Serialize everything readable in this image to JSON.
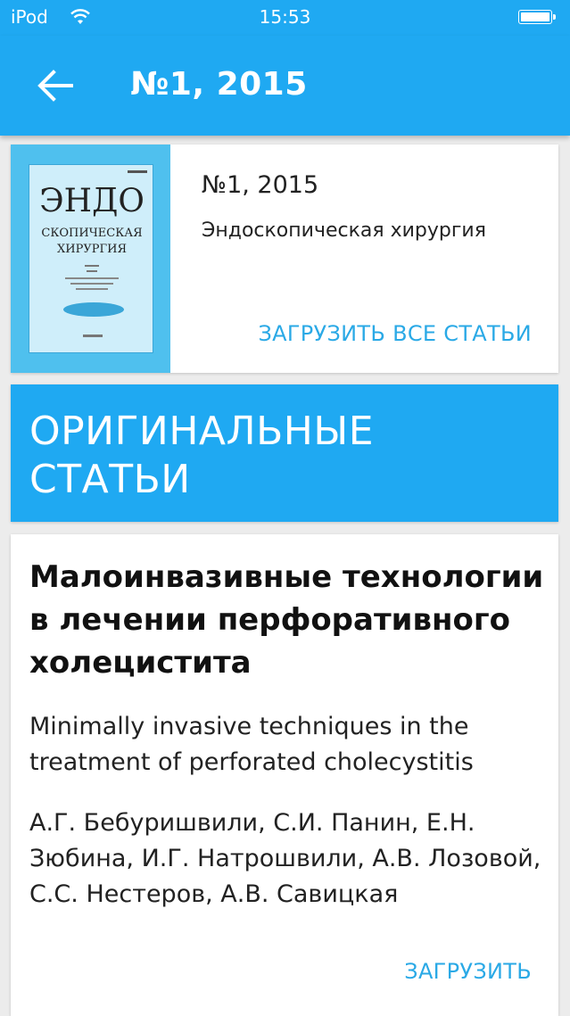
{
  "status_bar": {
    "carrier": "iPod",
    "time": "15:53",
    "wifi_icon": "wifi-icon",
    "battery_icon": "battery-icon"
  },
  "app_bar": {
    "back_icon": "arrow-left-icon",
    "title": "№1, 2015",
    "color": "#1fa9f2"
  },
  "issue": {
    "number": "№1, 2015",
    "journal": "Эндоскопическая хирургия",
    "download_all_label": "ЗАГРУЗИТЬ ВСЕ СТАТЬИ",
    "cover": {
      "title_line1": "ЭНДО",
      "title_line2": "СКОПИЧЕСКАЯ",
      "title_line3": "ХИРУРГИЯ"
    }
  },
  "section": {
    "title": "ОРИГИНАЛЬНЫЕ СТАТЬИ"
  },
  "article": {
    "title_ru": "Малоинвазивные технологии в лечении перфоративного холецистита",
    "title_en": "Minimally invasive techniques in the treatment of perforated cholecystitis",
    "authors": "А.Г. Бебуришвили, С.И. Панин, Е.Н. Зюбина, И.Г. Натрошвили, А.В. Лозовой, С.С. Нестеров, А.В. Савицкая",
    "download_label": "ЗАГРУЗИТЬ"
  },
  "colors": {
    "accent": "#1fa9f2",
    "link": "#2aa9e6",
    "background": "#ececec"
  }
}
